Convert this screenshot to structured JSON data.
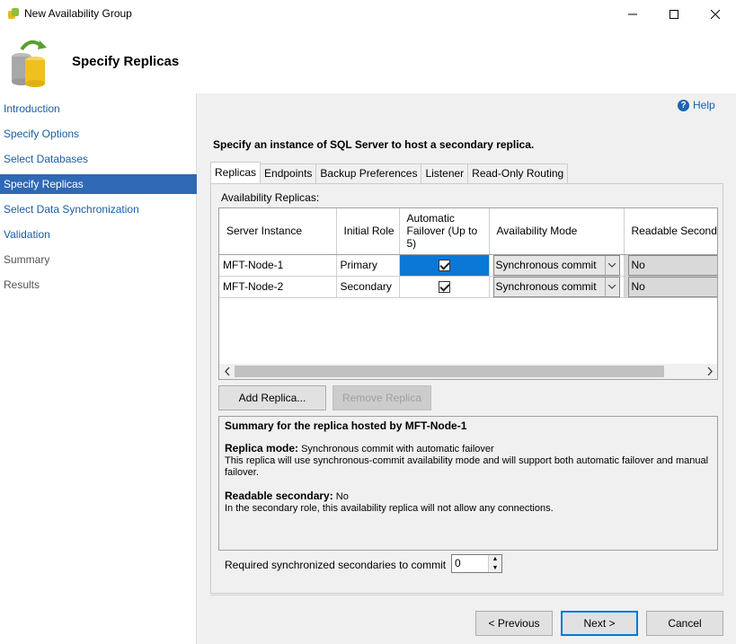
{
  "window": {
    "title": "New Availability Group"
  },
  "header": {
    "title": "Specify Replicas"
  },
  "nav": {
    "items": [
      {
        "label": "Introduction",
        "state": "link"
      },
      {
        "label": "Specify Options",
        "state": "link"
      },
      {
        "label": "Select Databases",
        "state": "link"
      },
      {
        "label": "Specify Replicas",
        "state": "active"
      },
      {
        "label": "Select Data Synchronization",
        "state": "link"
      },
      {
        "label": "Validation",
        "state": "link"
      },
      {
        "label": "Summary",
        "state": "disabled"
      },
      {
        "label": "Results",
        "state": "disabled"
      }
    ]
  },
  "help": {
    "label": "Help"
  },
  "instruction": "Specify an instance of SQL Server to host a secondary replica.",
  "tabs": [
    "Replicas",
    "Endpoints",
    "Backup Preferences",
    "Listener",
    "Read-Only Routing"
  ],
  "replicas": {
    "label": "Availability Replicas:",
    "columns": [
      "Server Instance",
      "Initial Role",
      "Automatic Failover (Up to 5)",
      "Availability Mode",
      "Readable Secondary"
    ],
    "rows": [
      {
        "server": "MFT-Node-1",
        "role": "Primary",
        "failover": true,
        "mode": "Synchronous commit",
        "readable": "No"
      },
      {
        "server": "MFT-Node-2",
        "role": "Secondary",
        "failover": true,
        "mode": "Synchronous commit",
        "readable": "No"
      }
    ]
  },
  "buttons": {
    "add_replica": "Add Replica...",
    "remove_replica": "Remove Replica",
    "previous": "< Previous",
    "next": "Next >",
    "cancel": "Cancel"
  },
  "summary": {
    "heading": "Summary for the replica hosted by MFT-Node-1",
    "mode_label": "Replica mode:",
    "mode_value": "Synchronous commit with automatic failover",
    "mode_desc": "This replica will use synchronous-commit availability mode and will support both automatic failover and manual failover.",
    "readable_label": "Readable secondary:",
    "readable_value": "No",
    "readable_desc": "In the secondary role, this availability replica will not allow any connections."
  },
  "required_sync": {
    "label": "Required synchronized secondaries to commit",
    "value": "0"
  },
  "colors": {
    "accent": "#2f68b4",
    "selection": "#0a78d7",
    "link": "#1a5ea6"
  }
}
